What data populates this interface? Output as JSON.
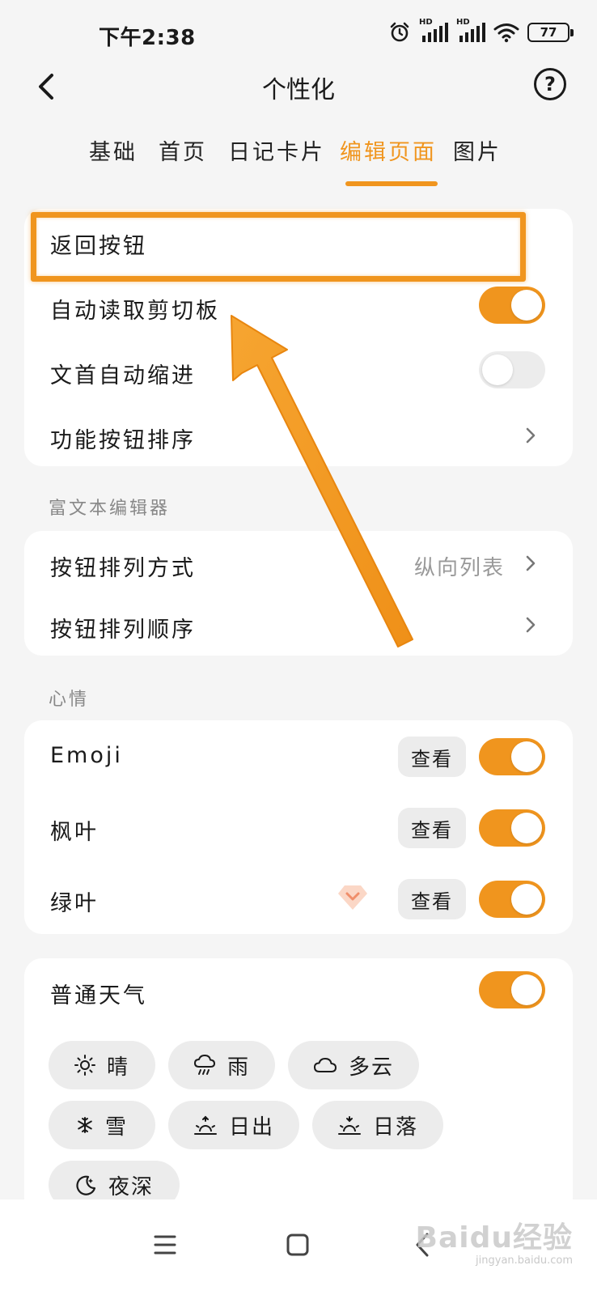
{
  "status_bar": {
    "time": "下午2:38",
    "network_label_1": "HD",
    "network_label_2": "HD",
    "battery": "77"
  },
  "header": {
    "title": "个性化",
    "help_symbol": "?"
  },
  "tabs": [
    {
      "label": "基础",
      "active": false
    },
    {
      "label": "首页",
      "active": false
    },
    {
      "label": "日记卡片",
      "active": false
    },
    {
      "label": "编辑页面",
      "active": true
    },
    {
      "label": "图片",
      "active": false
    }
  ],
  "editor_card": {
    "back_button": "返回按钮",
    "auto_clipboard": {
      "label": "自动读取剪切板",
      "enabled": true
    },
    "auto_indent": {
      "label": "文首自动缩进",
      "enabled": false
    },
    "button_order": "功能按钮排序"
  },
  "rich_text": {
    "section_title": "富文本编辑器",
    "layout": {
      "label": "按钮排列方式",
      "value": "纵向列表"
    },
    "order": {
      "label": "按钮排列顺序"
    }
  },
  "mood": {
    "section_title": "心情",
    "items": [
      {
        "label": "Emoji",
        "view": "查看",
        "enabled": true
      },
      {
        "label": "枫叶",
        "view": "查看",
        "enabled": true
      },
      {
        "label": "绿叶",
        "view": "查看",
        "enabled": true,
        "premium_icon": "diamond-icon"
      }
    ]
  },
  "weather": {
    "label": "普通天气",
    "enabled": true,
    "chips": [
      {
        "icon": "sun-icon",
        "label": "晴"
      },
      {
        "icon": "rain-icon",
        "label": "雨"
      },
      {
        "icon": "cloud-icon",
        "label": "多云"
      },
      {
        "icon": "snow-icon",
        "label": "雪"
      },
      {
        "icon": "sunrise-icon",
        "label": "日出"
      },
      {
        "icon": "sunset-icon",
        "label": "日落"
      },
      {
        "icon": "moon-icon",
        "label": "夜深"
      }
    ]
  },
  "watermark": {
    "main": "Baidu经验",
    "sub": "jingyan.baidu.com"
  },
  "colors": {
    "accent": "#f0951e",
    "background": "#f5f5f5",
    "card": "#ffffff",
    "toggle_off": "#ececec",
    "secondary_text": "#999999"
  }
}
